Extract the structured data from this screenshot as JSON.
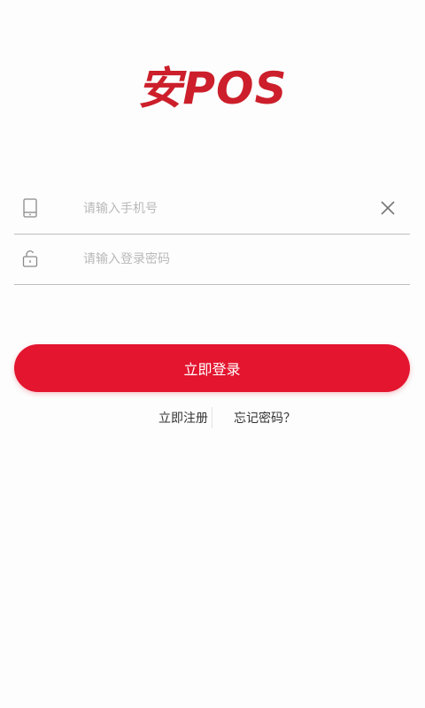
{
  "logo": {
    "text": "安POS"
  },
  "phone_field": {
    "value": "",
    "placeholder": "请输入手机号",
    "icon": "tablet-icon",
    "clear_icon": "close-icon"
  },
  "password_field": {
    "value": "",
    "placeholder": "请输入登录密码",
    "icon": "lock-icon"
  },
  "login_button": {
    "label": "立即登录"
  },
  "links": {
    "register": "立即注册",
    "forgot_password": "忘记密码？"
  },
  "colors": {
    "brand": "#cc1f2b",
    "primary_button": "#e3152f",
    "background": "#fdfdfd",
    "placeholder": "#b9b9b9",
    "link_text": "#333333"
  }
}
